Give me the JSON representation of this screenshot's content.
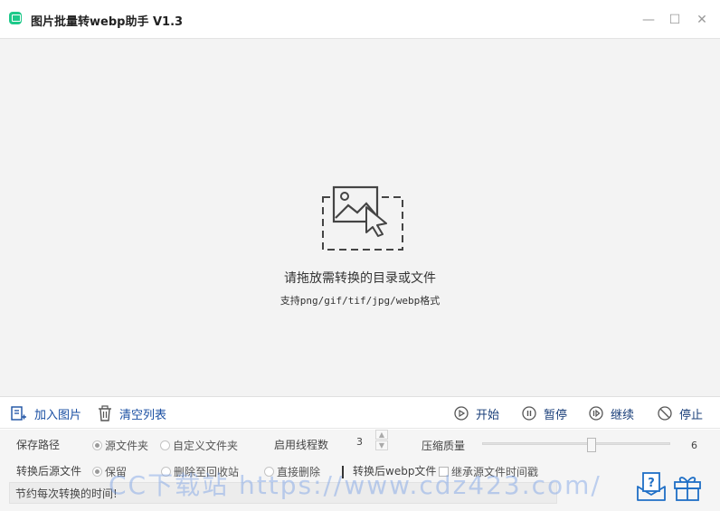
{
  "window": {
    "title": "图片批量转webp助手 V1.3",
    "controls": {
      "minimize": "—",
      "maximize": "☐",
      "close": "✕"
    }
  },
  "dropzone": {
    "icon": "image-drop-icon",
    "main_text": "请拖放需转换的目录或文件",
    "sub_text": "支持png/gif/tif/jpg/webp格式"
  },
  "toolbar": {
    "add_images": "加入图片",
    "clear_list": "清空列表",
    "start": "开始",
    "pause": "暂停",
    "resume": "继续",
    "stop": "停止"
  },
  "settings": {
    "save_path_label": "保存路径",
    "save_path_options": [
      "源文件夹",
      "自定义文件夹"
    ],
    "save_path_selected": "源文件夹",
    "threads_label": "启用线程数",
    "threads_value": "3",
    "quality_label": "压缩质量",
    "quality_value": "6",
    "quality_fraction": 0.58,
    "after_convert_label": "转换后源文件",
    "after_convert_options": [
      "保留",
      "删除至回收站",
      "直接删除"
    ],
    "after_convert_selected": "保留",
    "webp_after_label": "转换后webp文件",
    "inherit_time_label": "继承源文件时间戳",
    "inherit_time_checked": false,
    "time_saved_text": "节约每次转换的时间!",
    "watermark": "CC下载站 https://www.cdz423.com/"
  },
  "colors": {
    "accent": "#1a4fa3",
    "app_icon": "#1ec98a",
    "gift": "#1f6fc6"
  }
}
